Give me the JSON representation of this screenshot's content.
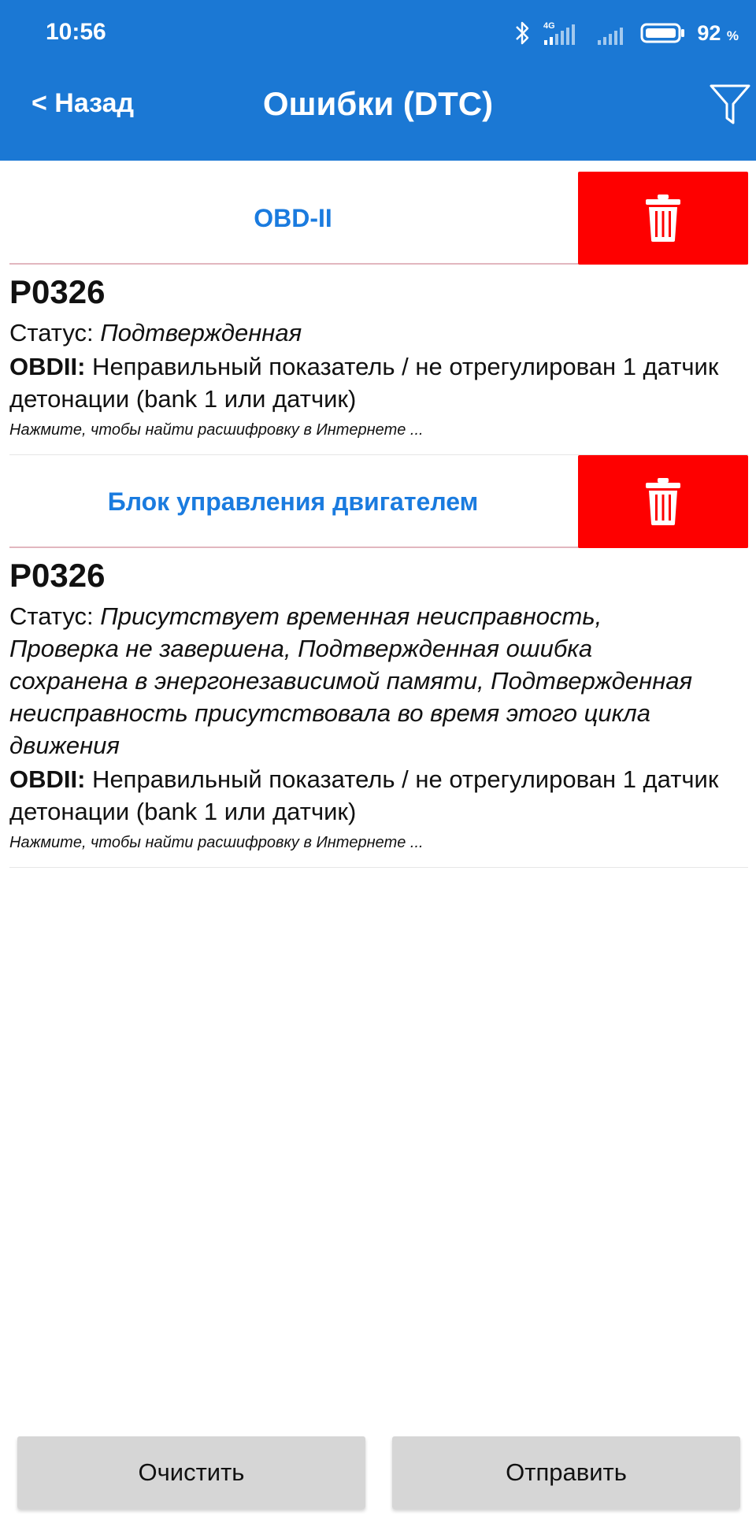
{
  "status_bar": {
    "time": "10:56",
    "network": "4G",
    "battery_percent": "92",
    "battery_unit": "%"
  },
  "header": {
    "back_label": "< Назад",
    "title": "Ошибки (DTC)",
    "filter_icon": "filter-icon"
  },
  "sections": [
    {
      "label": "OBD-II",
      "delete_icon": "trash-icon",
      "entries": [
        {
          "code": "P0326",
          "status_label": "Статус: ",
          "status_value": "Подтвержденная",
          "desc_label": "OBDII:",
          "desc_text": " Неправильный показатель / не отрегулирован 1 датчик детонации (bank 1 или датчик)",
          "hint": "Нажмите, чтобы найти расшифровку в Интернете ..."
        }
      ]
    },
    {
      "label": "Блок управления двигателем",
      "delete_icon": "trash-icon",
      "entries": [
        {
          "code": "P0326",
          "status_label": "Статус: ",
          "status_value": "Присутствует временная неисправность, Проверка не завершена, Подтвержденная ошибка сохранена в энергонезависимой памяти, Подтвержденная неисправность присутствовала во время этого цикла движения",
          "desc_label": "OBDII:",
          "desc_text": " Неправильный показатель / не отрегулирован 1 датчик детонации (bank 1 или датчик)",
          "hint": "Нажмите, чтобы найти расшифровку в Интернете ..."
        }
      ]
    }
  ],
  "buttons": {
    "clear_label": "Очистить",
    "send_label": "Отправить"
  },
  "colors": {
    "header_bg": "#1b78d4",
    "section_label": "#1a7bdf",
    "delete_bg": "#fe0000",
    "button_bg": "#d6d6d6"
  }
}
